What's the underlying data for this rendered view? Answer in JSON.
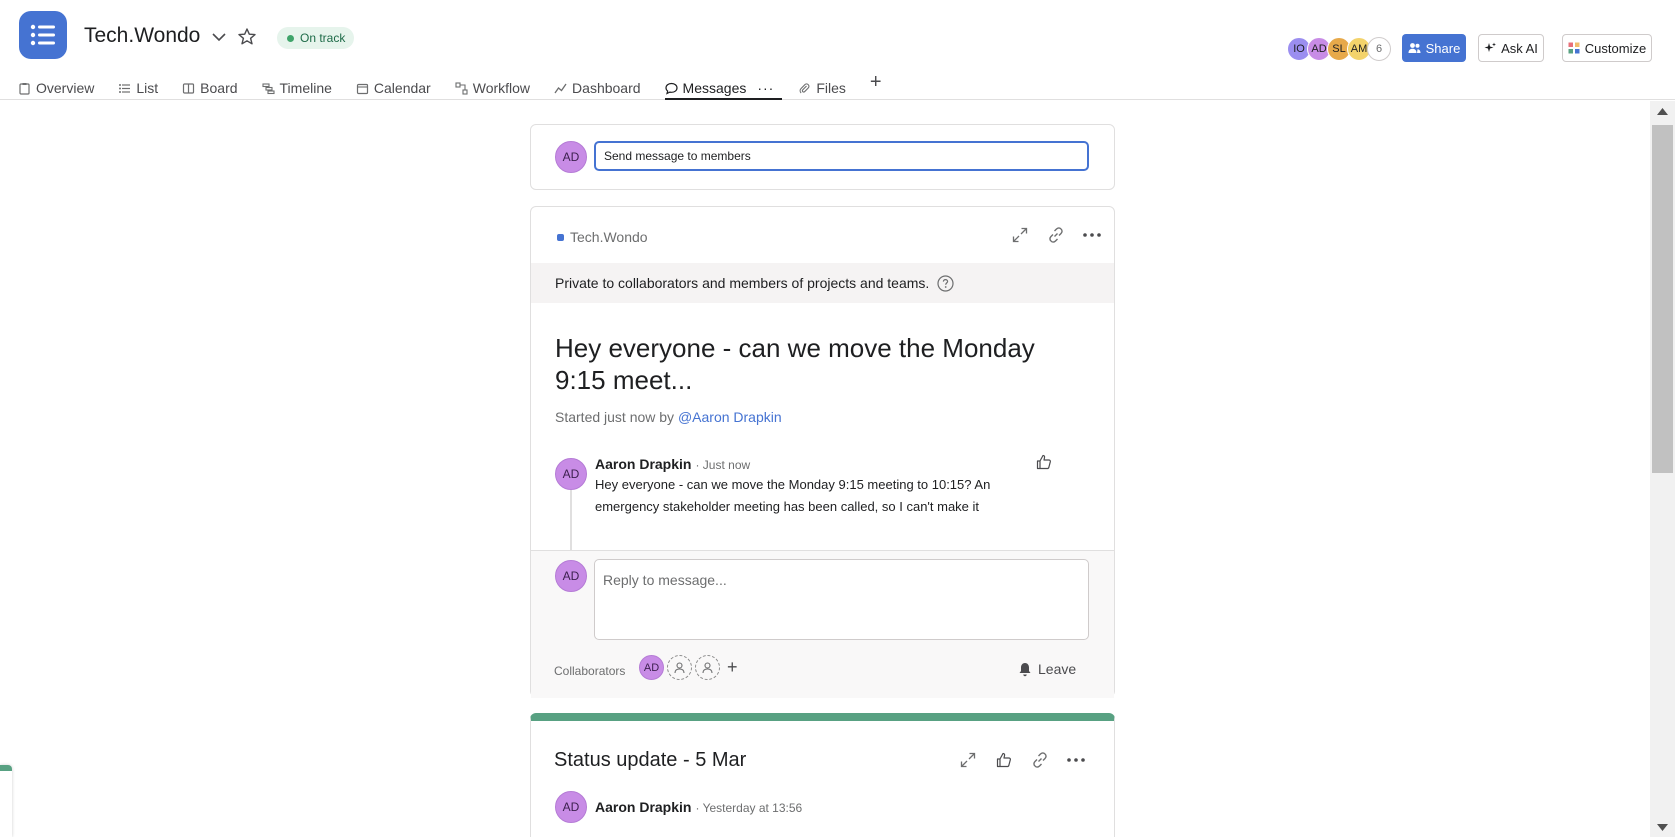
{
  "header": {
    "project_title": "Tech.Wondo",
    "status_label": "On track",
    "share_label": "Share",
    "ask_ai_label": "Ask AI",
    "customize_label": "Customize",
    "member_avatars": [
      {
        "initials": "IO",
        "color": "#9b8ef0"
      },
      {
        "initials": "AD",
        "color": "#c88ce6"
      },
      {
        "initials": "SL",
        "color": "#e7a94a"
      },
      {
        "initials": "AM",
        "color": "#f3d36b"
      }
    ],
    "member_count": "6"
  },
  "tabs": [
    {
      "label": "Overview",
      "icon": "clipboard-icon"
    },
    {
      "label": "List",
      "icon": "list-icon"
    },
    {
      "label": "Board",
      "icon": "board-icon"
    },
    {
      "label": "Timeline",
      "icon": "timeline-icon"
    },
    {
      "label": "Calendar",
      "icon": "calendar-icon"
    },
    {
      "label": "Workflow",
      "icon": "workflow-icon"
    },
    {
      "label": "Dashboard",
      "icon": "dashboard-icon"
    },
    {
      "label": "Messages",
      "icon": "message-icon",
      "active": true
    },
    {
      "label": "Files",
      "icon": "paperclip-icon"
    }
  ],
  "compose": {
    "avatar_initials": "AD",
    "placeholder": "Send message to members"
  },
  "message": {
    "project_tag": "Tech.Wondo",
    "privacy_text": "Private to collaborators and members of projects and teams.",
    "title": "Hey everyone - can we move the Monday 9:15 meet...",
    "started_prefix": "Started just now by ",
    "started_by": "@Aaron Drapkin",
    "comment": {
      "author": "Aaron Drapkin",
      "time": "· Just now",
      "body": "Hey everyone - can we move the Monday 9:15 meeting to 10:15? An emergency stakeholder meeting has been called, so I can't make it"
    },
    "reply_placeholder": "Reply to message...",
    "collaborators_label": "Collaborators",
    "collaborator_initials": "AD",
    "leave_label": "Leave"
  },
  "status_update": {
    "title": "Status update - 5 Mar",
    "author": "Aaron Drapkin",
    "time": "· Yesterday at 13:56"
  },
  "colors": {
    "brand": "#4573d2",
    "on_track_green": "#3fa46a",
    "avatar_purple": "#c88ce6"
  }
}
